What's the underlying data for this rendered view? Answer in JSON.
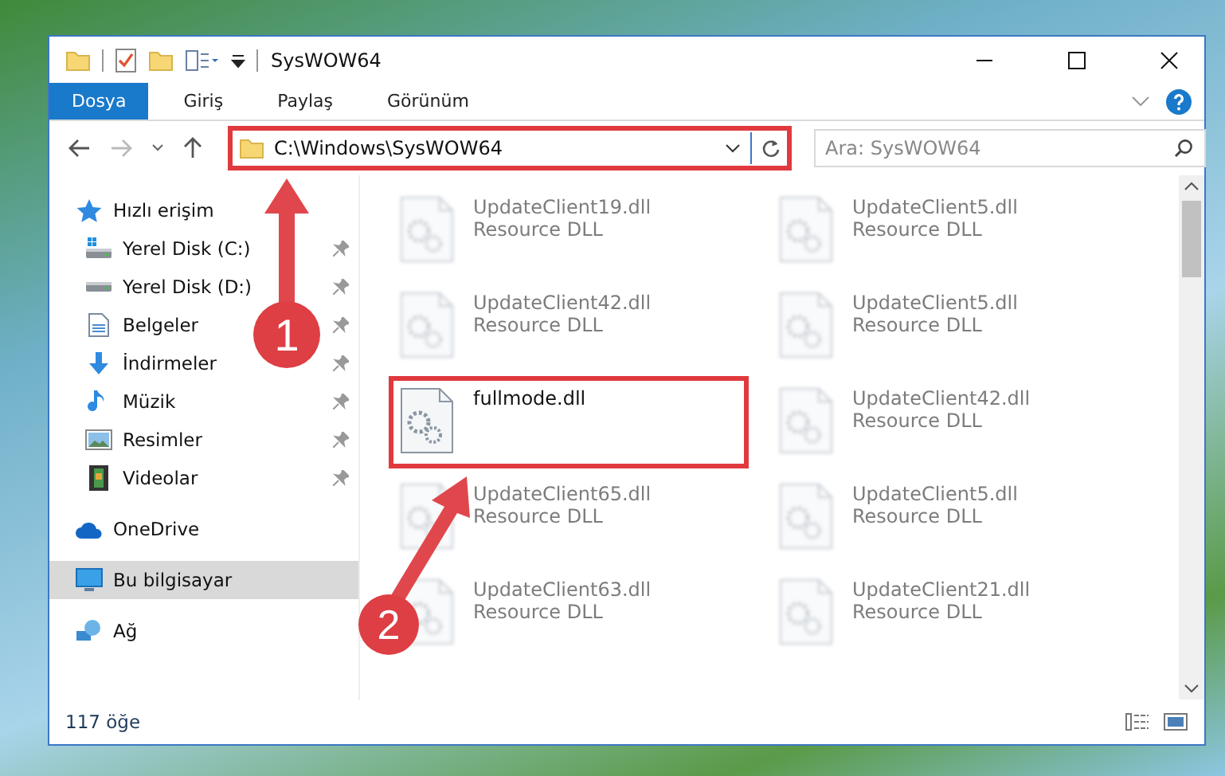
{
  "window": {
    "title": "SysWOW64"
  },
  "ribbon_tabs": [
    {
      "label": "Dosya",
      "selected": true
    },
    {
      "label": "Giriş",
      "selected": false
    },
    {
      "label": "Paylaş",
      "selected": false
    },
    {
      "label": "Görünüm",
      "selected": false
    }
  ],
  "address_bar": {
    "path": "C:\\Windows\\SysWOW64",
    "highlighted": true
  },
  "search": {
    "placeholder": "Ara: SysWOW64"
  },
  "sidebar": {
    "items": [
      {
        "label": "Hızlı erişim",
        "kind": "star",
        "selected": false,
        "children": [
          {
            "label": "Yerel Disk (C:)",
            "kind": "drive-c",
            "pinned": true
          },
          {
            "label": "Yerel Disk (D:)",
            "kind": "drive",
            "pinned": true
          },
          {
            "label": "Belgeler",
            "kind": "document",
            "pinned": true
          },
          {
            "label": "İndirmeler",
            "kind": "download",
            "pinned": true
          },
          {
            "label": "Müzik",
            "kind": "music",
            "pinned": true
          },
          {
            "label": "Resimler",
            "kind": "pictures",
            "pinned": true
          },
          {
            "label": "Videolar",
            "kind": "video",
            "pinned": true
          }
        ]
      },
      {
        "label": "OneDrive",
        "kind": "cloud",
        "selected": false
      },
      {
        "label": "Bu bilgisayar",
        "kind": "computer",
        "selected": true
      },
      {
        "label": "Ağ",
        "kind": "network",
        "selected": false
      }
    ]
  },
  "files": [
    {
      "name": "UpdateClient19.dll",
      "type": "Resource DLL",
      "blurred": true,
      "highlighted": false
    },
    {
      "name": "UpdateClient5.dll",
      "type": "Resource DLL",
      "blurred": true,
      "highlighted": false
    },
    {
      "name": "UpdateClient42.dll",
      "type": "Resource DLL",
      "blurred": true,
      "highlighted": false
    },
    {
      "name": "UpdateClient5.dll",
      "type": "Resource DLL",
      "blurred": true,
      "highlighted": false
    },
    {
      "name": "fullmode.dll",
      "blurred": false,
      "highlighted": true
    },
    {
      "name": "UpdateClient42.dll",
      "type": "Resource DLL",
      "blurred": true,
      "highlighted": false
    },
    {
      "name": "UpdateClient65.dll",
      "type": "Resource DLL",
      "blurred": true,
      "highlighted": false
    },
    {
      "name": "UpdateClient5.dll",
      "type": "Resource DLL",
      "blurred": true,
      "highlighted": false
    },
    {
      "name": "UpdateClient63.dll",
      "type": "Resource DLL",
      "blurred": true,
      "highlighted": false
    },
    {
      "name": "UpdateClient21.dll",
      "type": "Resource DLL",
      "blurred": true,
      "highlighted": false
    }
  ],
  "status_bar": {
    "count": "117 öğe"
  },
  "annotations": [
    {
      "number": "1"
    },
    {
      "number": "2"
    }
  ]
}
